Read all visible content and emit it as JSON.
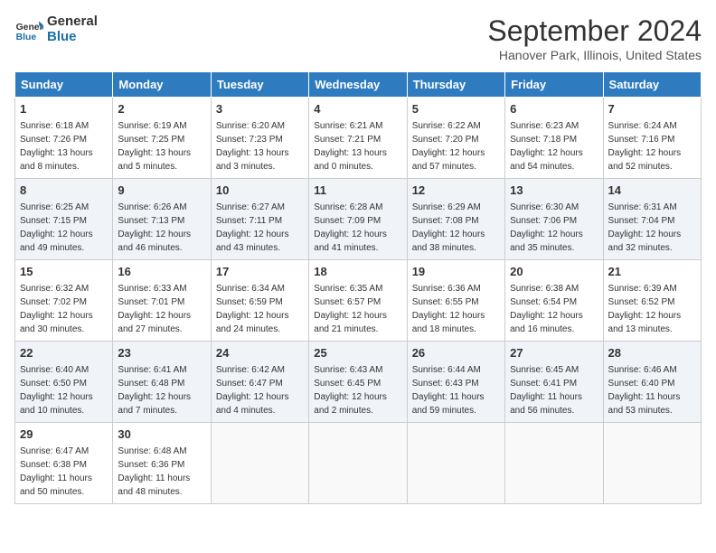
{
  "header": {
    "logo_line1": "General",
    "logo_line2": "Blue",
    "month": "September 2024",
    "location": "Hanover Park, Illinois, United States"
  },
  "weekdays": [
    "Sunday",
    "Monday",
    "Tuesday",
    "Wednesday",
    "Thursday",
    "Friday",
    "Saturday"
  ],
  "weeks": [
    [
      {
        "day": "1",
        "sunrise": "Sunrise: 6:18 AM",
        "sunset": "Sunset: 7:26 PM",
        "daylight": "Daylight: 13 hours and 8 minutes."
      },
      {
        "day": "2",
        "sunrise": "Sunrise: 6:19 AM",
        "sunset": "Sunset: 7:25 PM",
        "daylight": "Daylight: 13 hours and 5 minutes."
      },
      {
        "day": "3",
        "sunrise": "Sunrise: 6:20 AM",
        "sunset": "Sunset: 7:23 PM",
        "daylight": "Daylight: 13 hours and 3 minutes."
      },
      {
        "day": "4",
        "sunrise": "Sunrise: 6:21 AM",
        "sunset": "Sunset: 7:21 PM",
        "daylight": "Daylight: 13 hours and 0 minutes."
      },
      {
        "day": "5",
        "sunrise": "Sunrise: 6:22 AM",
        "sunset": "Sunset: 7:20 PM",
        "daylight": "Daylight: 12 hours and 57 minutes."
      },
      {
        "day": "6",
        "sunrise": "Sunrise: 6:23 AM",
        "sunset": "Sunset: 7:18 PM",
        "daylight": "Daylight: 12 hours and 54 minutes."
      },
      {
        "day": "7",
        "sunrise": "Sunrise: 6:24 AM",
        "sunset": "Sunset: 7:16 PM",
        "daylight": "Daylight: 12 hours and 52 minutes."
      }
    ],
    [
      {
        "day": "8",
        "sunrise": "Sunrise: 6:25 AM",
        "sunset": "Sunset: 7:15 PM",
        "daylight": "Daylight: 12 hours and 49 minutes."
      },
      {
        "day": "9",
        "sunrise": "Sunrise: 6:26 AM",
        "sunset": "Sunset: 7:13 PM",
        "daylight": "Daylight: 12 hours and 46 minutes."
      },
      {
        "day": "10",
        "sunrise": "Sunrise: 6:27 AM",
        "sunset": "Sunset: 7:11 PM",
        "daylight": "Daylight: 12 hours and 43 minutes."
      },
      {
        "day": "11",
        "sunrise": "Sunrise: 6:28 AM",
        "sunset": "Sunset: 7:09 PM",
        "daylight": "Daylight: 12 hours and 41 minutes."
      },
      {
        "day": "12",
        "sunrise": "Sunrise: 6:29 AM",
        "sunset": "Sunset: 7:08 PM",
        "daylight": "Daylight: 12 hours and 38 minutes."
      },
      {
        "day": "13",
        "sunrise": "Sunrise: 6:30 AM",
        "sunset": "Sunset: 7:06 PM",
        "daylight": "Daylight: 12 hours and 35 minutes."
      },
      {
        "day": "14",
        "sunrise": "Sunrise: 6:31 AM",
        "sunset": "Sunset: 7:04 PM",
        "daylight": "Daylight: 12 hours and 32 minutes."
      }
    ],
    [
      {
        "day": "15",
        "sunrise": "Sunrise: 6:32 AM",
        "sunset": "Sunset: 7:02 PM",
        "daylight": "Daylight: 12 hours and 30 minutes."
      },
      {
        "day": "16",
        "sunrise": "Sunrise: 6:33 AM",
        "sunset": "Sunset: 7:01 PM",
        "daylight": "Daylight: 12 hours and 27 minutes."
      },
      {
        "day": "17",
        "sunrise": "Sunrise: 6:34 AM",
        "sunset": "Sunset: 6:59 PM",
        "daylight": "Daylight: 12 hours and 24 minutes."
      },
      {
        "day": "18",
        "sunrise": "Sunrise: 6:35 AM",
        "sunset": "Sunset: 6:57 PM",
        "daylight": "Daylight: 12 hours and 21 minutes."
      },
      {
        "day": "19",
        "sunrise": "Sunrise: 6:36 AM",
        "sunset": "Sunset: 6:55 PM",
        "daylight": "Daylight: 12 hours and 18 minutes."
      },
      {
        "day": "20",
        "sunrise": "Sunrise: 6:38 AM",
        "sunset": "Sunset: 6:54 PM",
        "daylight": "Daylight: 12 hours and 16 minutes."
      },
      {
        "day": "21",
        "sunrise": "Sunrise: 6:39 AM",
        "sunset": "Sunset: 6:52 PM",
        "daylight": "Daylight: 12 hours and 13 minutes."
      }
    ],
    [
      {
        "day": "22",
        "sunrise": "Sunrise: 6:40 AM",
        "sunset": "Sunset: 6:50 PM",
        "daylight": "Daylight: 12 hours and 10 minutes."
      },
      {
        "day": "23",
        "sunrise": "Sunrise: 6:41 AM",
        "sunset": "Sunset: 6:48 PM",
        "daylight": "Daylight: 12 hours and 7 minutes."
      },
      {
        "day": "24",
        "sunrise": "Sunrise: 6:42 AM",
        "sunset": "Sunset: 6:47 PM",
        "daylight": "Daylight: 12 hours and 4 minutes."
      },
      {
        "day": "25",
        "sunrise": "Sunrise: 6:43 AM",
        "sunset": "Sunset: 6:45 PM",
        "daylight": "Daylight: 12 hours and 2 minutes."
      },
      {
        "day": "26",
        "sunrise": "Sunrise: 6:44 AM",
        "sunset": "Sunset: 6:43 PM",
        "daylight": "Daylight: 11 hours and 59 minutes."
      },
      {
        "day": "27",
        "sunrise": "Sunrise: 6:45 AM",
        "sunset": "Sunset: 6:41 PM",
        "daylight": "Daylight: 11 hours and 56 minutes."
      },
      {
        "day": "28",
        "sunrise": "Sunrise: 6:46 AM",
        "sunset": "Sunset: 6:40 PM",
        "daylight": "Daylight: 11 hours and 53 minutes."
      }
    ],
    [
      {
        "day": "29",
        "sunrise": "Sunrise: 6:47 AM",
        "sunset": "Sunset: 6:38 PM",
        "daylight": "Daylight: 11 hours and 50 minutes."
      },
      {
        "day": "30",
        "sunrise": "Sunrise: 6:48 AM",
        "sunset": "Sunset: 6:36 PM",
        "daylight": "Daylight: 11 hours and 48 minutes."
      },
      null,
      null,
      null,
      null,
      null
    ]
  ]
}
